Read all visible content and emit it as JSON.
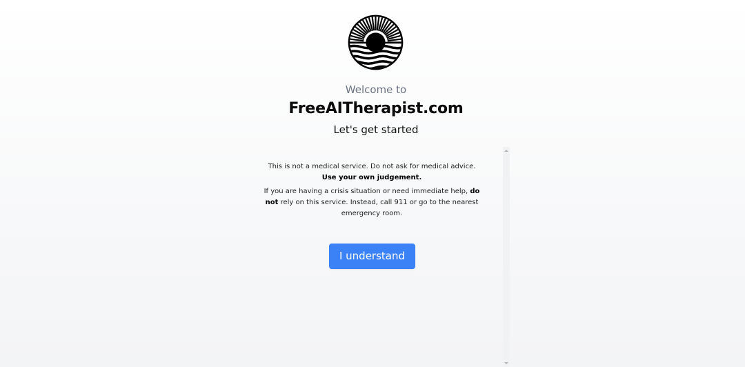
{
  "header": {
    "logo_icon": "sunset-over-waves-icon",
    "welcome": "Welcome to",
    "site_name": "FreeAITherapist.com",
    "subtitle": "Let's get started"
  },
  "disclaimer": {
    "p1_text": "This is not a medical service. Do not ask for medical advice. ",
    "p1_bold": "Use your own judgement.",
    "p2_text_a": "If you are having a crisis situation or need immediate help, ",
    "p2_bold": "do not",
    "p2_text_b": " rely on this service. Instead, call 911 or go to the nearest emergency room."
  },
  "actions": {
    "understand_label": "I understand"
  },
  "colors": {
    "button_bg": "#3b82f6",
    "button_text": "#ffffff",
    "muted_text": "#6b7280"
  }
}
